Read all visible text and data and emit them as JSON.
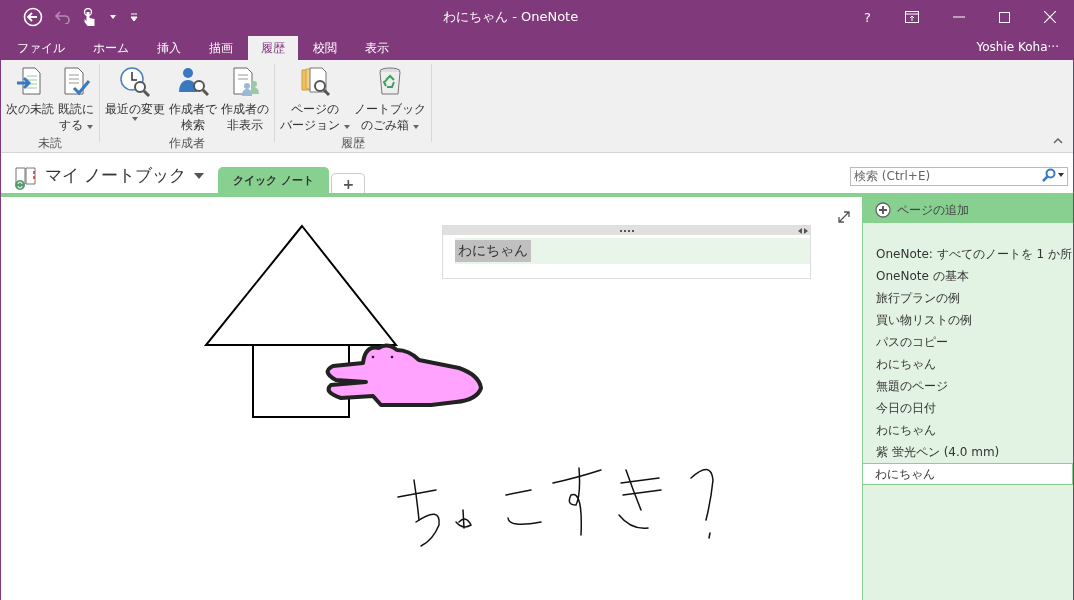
{
  "window": {
    "title": "わにちゃん - OneNote",
    "help": "?"
  },
  "user": "Yoshie Koha···",
  "tabs": [
    {
      "label": "ファイル",
      "selected": false
    },
    {
      "label": "ホーム",
      "selected": false
    },
    {
      "label": "挿入",
      "selected": false
    },
    {
      "label": "描画",
      "selected": false
    },
    {
      "label": "履歴",
      "selected": true
    },
    {
      "label": "校閲",
      "selected": false
    },
    {
      "label": "表示",
      "selected": false
    }
  ],
  "ribbon_groups": [
    {
      "label": "未読",
      "buttons": [
        {
          "lines": [
            "次の未読"
          ],
          "has_menu": false
        },
        {
          "lines": [
            "既読に",
            "する"
          ],
          "has_menu": true
        }
      ]
    },
    {
      "label": "作成者",
      "buttons": [
        {
          "lines": [
            "最近の変更"
          ],
          "has_menu": true
        },
        {
          "lines": [
            "作成者で",
            "検索"
          ],
          "has_menu": false
        },
        {
          "lines": [
            "作成者の",
            "非表示"
          ],
          "has_menu": false
        }
      ]
    },
    {
      "label": "履歴",
      "buttons": [
        {
          "lines": [
            "ページの",
            "バージョン"
          ],
          "has_menu": true
        },
        {
          "lines": [
            "ノートブック",
            "のごみ箱"
          ],
          "has_menu": true
        }
      ]
    }
  ],
  "notebook": {
    "name": "マイ ノートブック",
    "sections": [
      {
        "label": "クイック ノート",
        "selected": true
      }
    ],
    "add_section": "+"
  },
  "search": {
    "placeholder": "検索 (Ctrl+E)"
  },
  "note": {
    "text": "わにちゃん",
    "selected": true
  },
  "pages_panel": {
    "add_page": "ページの追加",
    "pages": [
      {
        "title": "OneNote: すべてのノートを 1 か所",
        "selected": false
      },
      {
        "title": "OneNote の基本",
        "selected": false
      },
      {
        "title": "旅行プランの例",
        "selected": false
      },
      {
        "title": "買い物リストの例",
        "selected": false
      },
      {
        "title": "パスのコピー",
        "selected": false
      },
      {
        "title": "わにちゃん",
        "selected": false
      },
      {
        "title": "無題のページ",
        "selected": false
      },
      {
        "title": "今日の日付",
        "selected": false
      },
      {
        "title": "わにちゃん",
        "selected": false
      },
      {
        "title": "紫 蛍光ペン (4.0 mm)",
        "selected": false
      },
      {
        "title": "わにちゃん",
        "selected": true
      }
    ]
  }
}
